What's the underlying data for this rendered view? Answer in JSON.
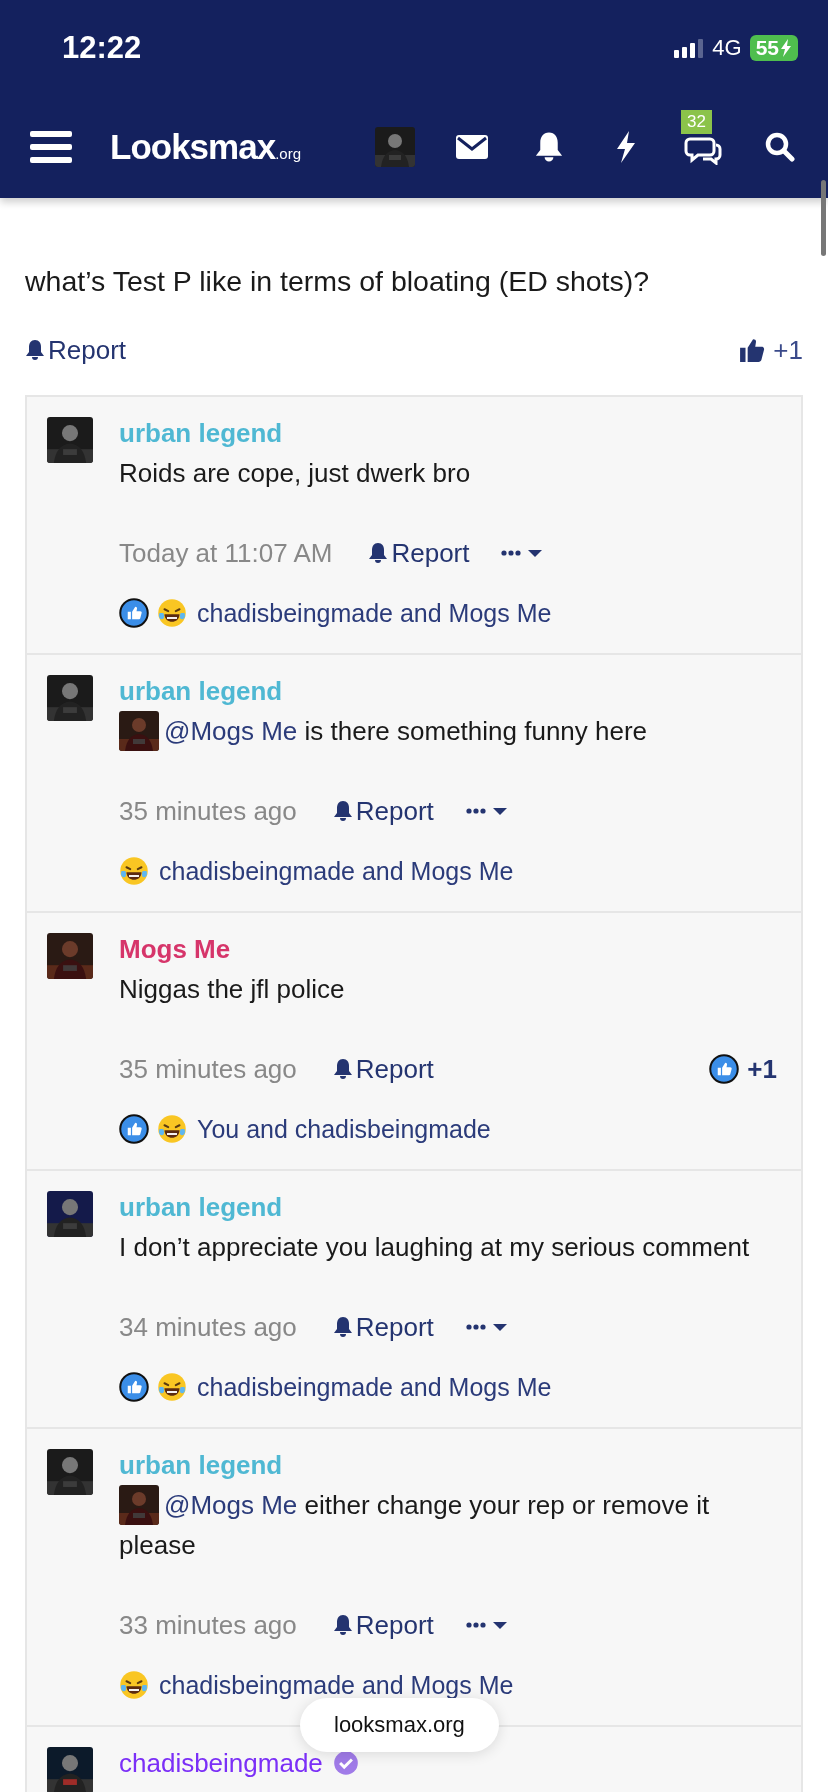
{
  "status_bar": {
    "time": "12:22",
    "network": "4G",
    "battery": "55"
  },
  "nav": {
    "logo": "Looksmax",
    "logo_suffix": ".org",
    "chat_badge": "32"
  },
  "post": {
    "text": "what’s Test P like in terms of bloating (ED shots)?",
    "report": "Report",
    "score": "+1"
  },
  "comments": [
    {
      "author": "urban legend",
      "color": "#4fb8d3",
      "text": "Roids are cope, just dwerk bro",
      "time": "Today at 11:07 AM",
      "report": "Report",
      "has_menu": true,
      "reactions": [
        {
          "kind": "like"
        },
        {
          "kind": "haha"
        }
      ],
      "reacted_by": "chadisbeingmade and Mogs Me"
    },
    {
      "author": "urban legend",
      "color": "#4fb8d3",
      "mention": "@Mogs Me",
      "text": " is there something funny here",
      "time": "35 minutes ago",
      "report": "Report",
      "has_menu": true,
      "reactions": [
        {
          "kind": "haha"
        }
      ],
      "reacted_by": "chadisbeingmade and Mogs Me"
    },
    {
      "author": "Mogs Me",
      "color": "#d6356a",
      "text": "Niggas the jfl police",
      "time": "35 minutes ago",
      "report": "Report",
      "has_menu": false,
      "score": "+1",
      "reactions": [
        {
          "kind": "like"
        },
        {
          "kind": "haha"
        }
      ],
      "reacted_by": "You and chadisbeingmade"
    },
    {
      "author": "urban legend",
      "color": "#4fb8d3",
      "text": "I don’t appreciate you laughing at my serious comment",
      "time": "34 minutes ago",
      "report": "Report",
      "has_menu": true,
      "reactions": [
        {
          "kind": "like"
        },
        {
          "kind": "haha"
        }
      ],
      "reacted_by": "chadisbeingmade and Mogs Me"
    },
    {
      "author": "urban legend",
      "color": "#4fb8d3",
      "mention": "@Mogs Me",
      "text": " either change your rep or remove it please",
      "time": "33 minutes ago",
      "report": "Report",
      "has_menu": true,
      "reactions": [
        {
          "kind": "haha"
        }
      ],
      "reacted_by": "chadisbeingmade and Mogs Me"
    },
    {
      "author": "chadisbeingmade",
      "color": "#7b2ff7",
      "verified": true
    }
  ],
  "url_pill": "looksmax.org"
}
